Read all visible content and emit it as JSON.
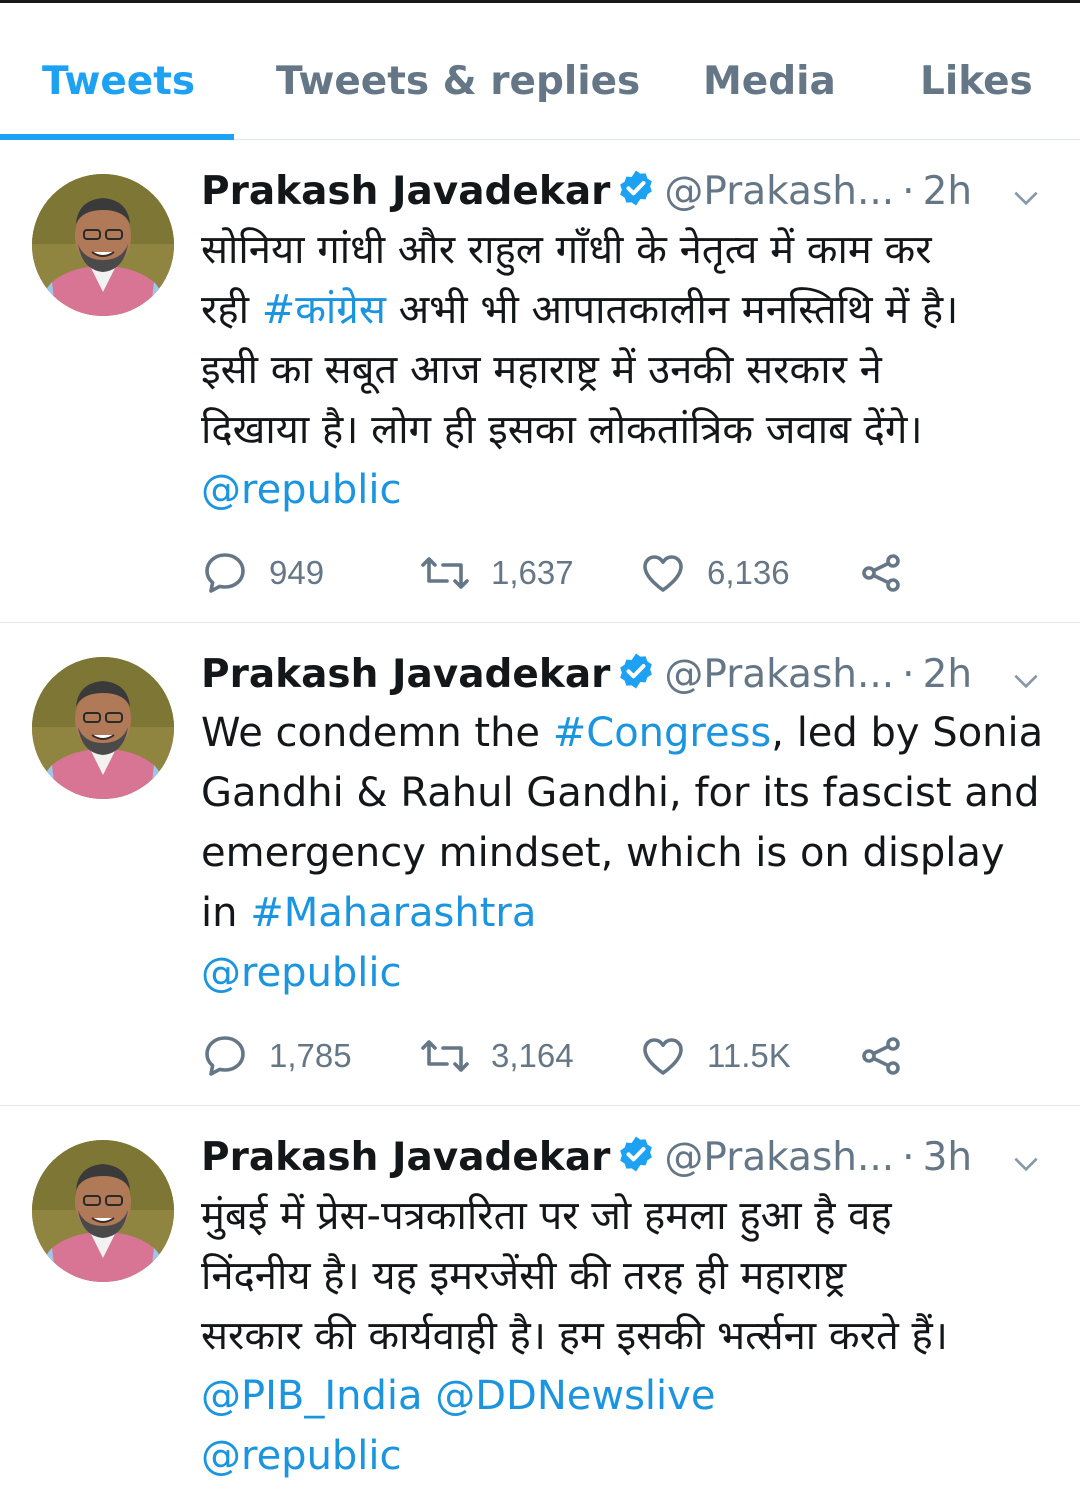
{
  "tabs": [
    {
      "label": "Tweets",
      "active": true
    },
    {
      "label": "Tweets & replies",
      "active": false
    },
    {
      "label": "Media",
      "active": false
    },
    {
      "label": "Likes",
      "active": false
    }
  ],
  "colors": {
    "accent": "#1da1f2",
    "link": "#1b95e0",
    "muted": "#657786"
  },
  "tweets": [
    {
      "name": "Prakash Javadekar",
      "handle": "@Prakash...",
      "sep": "·",
      "time": "2h",
      "verified": true,
      "lines": [
        [
          "सोनिया गांधी और राहुल गाँधी के नेतृत्व में काम कर"
        ],
        [
          "रही ",
          "#कांग्रेस",
          " अभी भी आपातकालीन मनस्तिथि में है।"
        ],
        [
          "इसी का सबूत आज महाराष्ट्र में उनकी सरकार ने"
        ],
        [
          "दिखाया है। लोग ही इसका लोकतांत्रिक जवाब देंगे।"
        ],
        [
          "@republic"
        ]
      ],
      "replies": "949",
      "retweets": "1,637",
      "likes": "6,136"
    },
    {
      "name": "Prakash Javadekar",
      "handle": "@Prakash...",
      "sep": "·",
      "time": "2h",
      "verified": true,
      "lines": [
        [
          "We condemn the ",
          "#Congress",
          ", led by Sonia"
        ],
        [
          "Gandhi & Rahul Gandhi, for its fascist and"
        ],
        [
          "emergency mindset, which is on display"
        ],
        [
          "in ",
          "#Maharashtra"
        ],
        [
          "@republic"
        ]
      ],
      "replies": "1,785",
      "retweets": "3,164",
      "likes": "11.5K"
    },
    {
      "name": "Prakash Javadekar",
      "handle": "@Prakash...",
      "sep": "·",
      "time": "3h",
      "verified": true,
      "lines": [
        [
          "मुंबई में प्रेस-पत्रकारिता पर जो हमला हुआ है वह"
        ],
        [
          "निंदनीय है। यह इमरजेंसी की तरह ही महाराष्ट्र"
        ],
        [
          "सरकार की कार्यवाही है। हम इसकी भर्त्सना करते हैं।"
        ],
        [
          "@PIB_India @DDNewslive"
        ],
        [
          "@republic"
        ]
      ]
    }
  ]
}
